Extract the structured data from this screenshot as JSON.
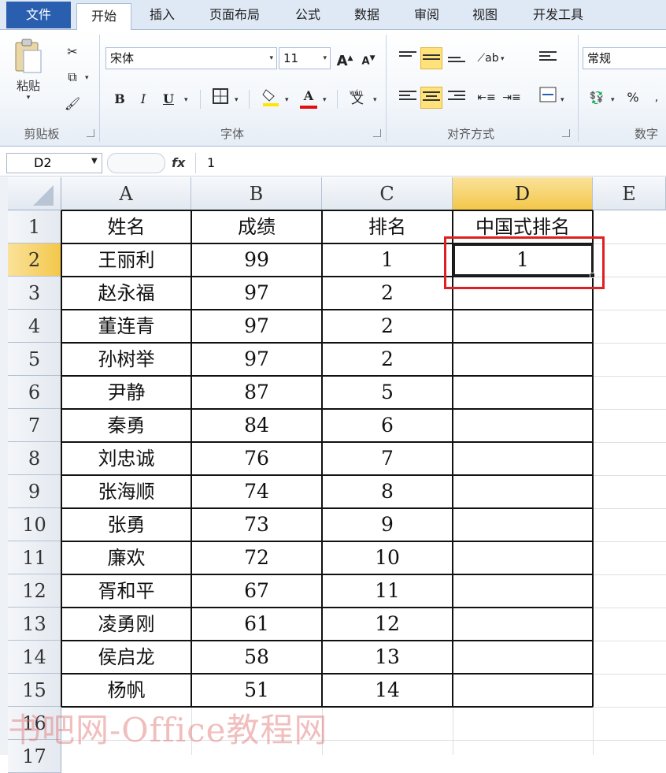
{
  "ribbon": {
    "tabs": [
      "文件",
      "开始",
      "插入",
      "页面布局",
      "公式",
      "数据",
      "审阅",
      "视图",
      "开发工具"
    ],
    "groups": {
      "clipboard": "剪贴板",
      "font": "字体",
      "alignment": "对齐方式",
      "number": "数字"
    },
    "paste_label": "粘贴",
    "font_name": "宋体",
    "font_size": "11",
    "number_format": "常规",
    "buttons": {
      "bold": "B",
      "italic": "I",
      "underline": "U",
      "percent": "%",
      "grow_font": "A",
      "shrink_font": "A",
      "font_color": "A",
      "phonetic": "wén"
    }
  },
  "formula_bar": {
    "name_box": "D2",
    "fx": "fx",
    "content": "1"
  },
  "columns": [
    "A",
    "B",
    "C",
    "D",
    "E"
  ],
  "selected_column": "D",
  "rows": [
    "1",
    "2",
    "3",
    "4",
    "5",
    "6",
    "7",
    "8",
    "9",
    "10",
    "11",
    "12",
    "13",
    "14",
    "15",
    "16",
    "17"
  ],
  "selected_row": "2",
  "header": {
    "name": "姓名",
    "score": "成绩",
    "rank": "排名",
    "cn_rank": "中国式排名"
  },
  "data_rows": [
    {
      "name": "王丽利",
      "score": "99",
      "rank": "1",
      "cn_rank": "1"
    },
    {
      "name": "赵永福",
      "score": "97",
      "rank": "2",
      "cn_rank": ""
    },
    {
      "name": "董连青",
      "score": "97",
      "rank": "2",
      "cn_rank": ""
    },
    {
      "name": "孙树举",
      "score": "97",
      "rank": "2",
      "cn_rank": ""
    },
    {
      "name": "尹静",
      "score": "87",
      "rank": "5",
      "cn_rank": ""
    },
    {
      "name": "秦勇",
      "score": "84",
      "rank": "6",
      "cn_rank": ""
    },
    {
      "name": "刘忠诚",
      "score": "76",
      "rank": "7",
      "cn_rank": ""
    },
    {
      "name": "张海顺",
      "score": "74",
      "rank": "8",
      "cn_rank": ""
    },
    {
      "name": "张勇",
      "score": "73",
      "rank": "9",
      "cn_rank": ""
    },
    {
      "name": "廉欢",
      "score": "72",
      "rank": "10",
      "cn_rank": ""
    },
    {
      "name": "胥和平",
      "score": "67",
      "rank": "11",
      "cn_rank": ""
    },
    {
      "name": "凌勇刚",
      "score": "61",
      "rank": "12",
      "cn_rank": ""
    },
    {
      "name": "侯启龙",
      "score": "58",
      "rank": "13",
      "cn_rank": ""
    },
    {
      "name": "杨帆",
      "score": "51",
      "rank": "14",
      "cn_rank": ""
    }
  ],
  "watermark": "书吧网-Office教程网",
  "colors": {
    "selection_highlight": "#ffe27a",
    "annotation_box": "#e02020",
    "file_tab": "#2a5faf"
  }
}
